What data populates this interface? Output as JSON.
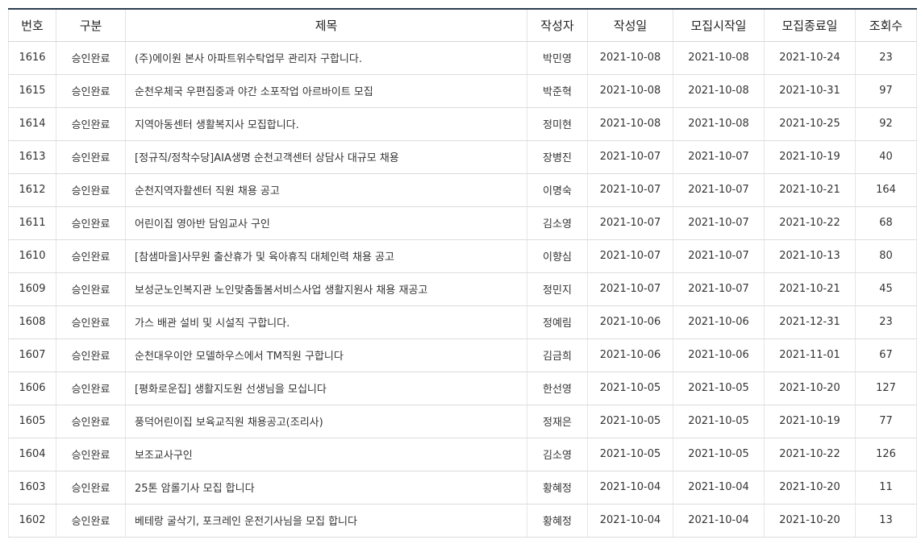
{
  "board": {
    "columns": [
      "번호",
      "구분",
      "제목",
      "작성자",
      "작성일",
      "모집시작일",
      "모집종료일",
      "조회수"
    ],
    "rows": [
      {
        "no": "1616",
        "category": "승인완료",
        "title": "(주)에이원 본사 아파트위수탁업무 관리자 구합니다.",
        "author": "박민영",
        "written": "2021-10-08",
        "start": "2021-10-08",
        "end": "2021-10-24",
        "views": "23"
      },
      {
        "no": "1615",
        "category": "승인완료",
        "title": "순천우체국 우편집중과 야간 소포작업 아르바이트 모집",
        "author": "박준혁",
        "written": "2021-10-08",
        "start": "2021-10-08",
        "end": "2021-10-31",
        "views": "97"
      },
      {
        "no": "1614",
        "category": "승인완료",
        "title": "지역아동센터 생활복지사 모집합니다.",
        "author": "정미현",
        "written": "2021-10-08",
        "start": "2021-10-08",
        "end": "2021-10-25",
        "views": "92"
      },
      {
        "no": "1613",
        "category": "승인완료",
        "title": "[정규직/정착수당]AIA생명 순천고객센터 상담사 대규모 채용",
        "author": "장병진",
        "written": "2021-10-07",
        "start": "2021-10-07",
        "end": "2021-10-19",
        "views": "40"
      },
      {
        "no": "1612",
        "category": "승인완료",
        "title": "순천지역자활센터 직원 채용 공고",
        "author": "이명숙",
        "written": "2021-10-07",
        "start": "2021-10-07",
        "end": "2021-10-21",
        "views": "164"
      },
      {
        "no": "1611",
        "category": "승인완료",
        "title": "어린이집 영아반 담임교사 구인",
        "author": "김소영",
        "written": "2021-10-07",
        "start": "2021-10-07",
        "end": "2021-10-22",
        "views": "68"
      },
      {
        "no": "1610",
        "category": "승인완료",
        "title": "[참샘마을]사무원 출산휴가 및 육아휴직 대체인력 채용 공고",
        "author": "이향심",
        "written": "2021-10-07",
        "start": "2021-10-07",
        "end": "2021-10-13",
        "views": "80"
      },
      {
        "no": "1609",
        "category": "승인완료",
        "title": "보성군노인복지관 노인맞춤돌봄서비스사업 생활지원사 채용 재공고",
        "author": "정민지",
        "written": "2021-10-07",
        "start": "2021-10-07",
        "end": "2021-10-21",
        "views": "45"
      },
      {
        "no": "1608",
        "category": "승인완료",
        "title": "가스 배관 설비 및 시설직 구합니다.",
        "author": "정예림",
        "written": "2021-10-06",
        "start": "2021-10-06",
        "end": "2021-12-31",
        "views": "23"
      },
      {
        "no": "1607",
        "category": "승인완료",
        "title": "순천대우이안 모델하우스에서 TM직원 구합니다",
        "author": "김금희",
        "written": "2021-10-06",
        "start": "2021-10-06",
        "end": "2021-11-01",
        "views": "67"
      },
      {
        "no": "1606",
        "category": "승인완료",
        "title": "[평화로운집] 생활지도원 선생님을 모십니다",
        "author": "한선영",
        "written": "2021-10-05",
        "start": "2021-10-05",
        "end": "2021-10-20",
        "views": "127"
      },
      {
        "no": "1605",
        "category": "승인완료",
        "title": "풍덕어린이집 보육교직원 채용공고(조리사)",
        "author": "정재은",
        "written": "2021-10-05",
        "start": "2021-10-05",
        "end": "2021-10-19",
        "views": "77"
      },
      {
        "no": "1604",
        "category": "승인완료",
        "title": "보조교사구인",
        "author": "김소영",
        "written": "2021-10-05",
        "start": "2021-10-05",
        "end": "2021-10-22",
        "views": "126"
      },
      {
        "no": "1603",
        "category": "승인완료",
        "title": "25톤 암롤기사 모집 합니다",
        "author": "황혜정",
        "written": "2021-10-04",
        "start": "2021-10-04",
        "end": "2021-10-20",
        "views": "11"
      },
      {
        "no": "1602",
        "category": "승인완료",
        "title": "베테랑 굴삭기, 포크레인 운전기사님을 모집 합니다",
        "author": "황혜정",
        "written": "2021-10-04",
        "start": "2021-10-04",
        "end": "2021-10-20",
        "views": "13"
      }
    ]
  },
  "colors": {
    "header_top_border": "#2c3e50",
    "row_border": "#dcdcdc",
    "text": "#333333"
  }
}
